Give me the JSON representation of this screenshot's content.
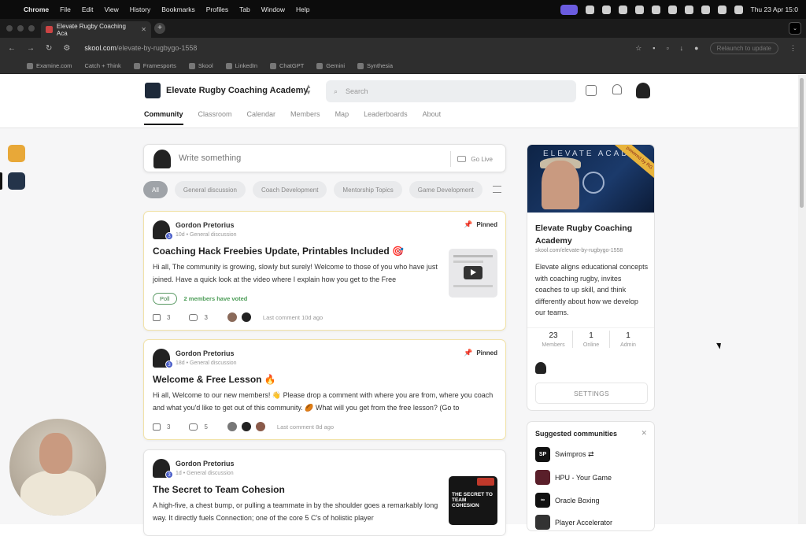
{
  "mac": {
    "app": "Chrome",
    "menus": [
      "File",
      "Edit",
      "View",
      "History",
      "Bookmarks",
      "Profiles",
      "Tab",
      "Window",
      "Help"
    ],
    "clock": "Thu 23 Apr  15:0"
  },
  "browser": {
    "tab_title": "Elevate Rugby Coaching Aca",
    "url_host": "skool.com",
    "url_path": "/elevate-by-rugbygo-1558",
    "relaunch": "Relaunch to update",
    "bookmarks": [
      "Examine.com",
      "Catch + Think",
      "Framesports",
      "Skool",
      "LinkedIn",
      "ChatGPT",
      "Gemini",
      "Synthesia"
    ]
  },
  "header": {
    "community_name": "Elevate Rugby Coaching Academy",
    "search_placeholder": "Search",
    "tabs": [
      "Community",
      "Classroom",
      "Calendar",
      "Members",
      "Map",
      "Leaderboards",
      "About"
    ]
  },
  "composer": {
    "placeholder": "Write something",
    "go_live": "Go Live"
  },
  "filters": [
    "All",
    "General discussion",
    "Coach Development",
    "Mentorship Topics",
    "Game Development"
  ],
  "posts": [
    {
      "author": "Gordon Pretorius",
      "level": "3",
      "meta": "10d • General discussion",
      "pinned": "Pinned",
      "title": "Coaching Hack Freebies Update, Printables Included 🎯",
      "body": "Hi all, The community is growing, slowly but surely! Welcome to those of you who have just joined. Have a quick look at the video where I explain how you get to the Free",
      "poll_tag": "Poll",
      "poll_votes": "2 members have voted",
      "likes": "3",
      "comments": "3",
      "last_comment": "Last comment 10d ago"
    },
    {
      "author": "Gordon Pretorius",
      "level": "3",
      "meta": "18d • General discussion",
      "pinned": "Pinned",
      "title": "Welcome & Free Lesson 🔥",
      "body": "Hi all, Welcome to our new members! 👋 Please drop a comment with where you are from, where you coach and what you'd like to get out of this community. 🏉 What will you get from the free lesson? (Go to",
      "likes": "3",
      "comments": "5",
      "last_comment": "Last comment 8d ago"
    },
    {
      "author": "Gordon Pretorius",
      "level": "3",
      "meta": "1d • General discussion",
      "title": "The Secret to Team Cohesion",
      "body": "A high-five, a chest bump, or pulling a teammate in by the shoulder goes a remarkably long way. It directly fuels Connection; one of the core 5 C's of holistic player",
      "thumb_text": "THE SECRET TO TEAM COHESION"
    }
  ],
  "about_card": {
    "banner_text": "ELEVATE ACADE",
    "banner_ribbon": "powered by RG",
    "title": "Elevate Rugby Coaching Academy",
    "url": "skool.com/elevate-by-rugbygo-1558",
    "description": "Elevate aligns educational concepts with coaching rugby, invites coaches to up skill, and think differently about how we develop our teams.",
    "stats": [
      {
        "value": "23",
        "label": "Members"
      },
      {
        "value": "1",
        "label": "Online"
      },
      {
        "value": "1",
        "label": "Admin"
      }
    ],
    "settings": "SETTINGS"
  },
  "suggested": {
    "title": "Suggested communities",
    "items": [
      {
        "abbr": "SP",
        "name": "Swimpros ⇄"
      },
      {
        "abbr": "",
        "name": "HPU - Your Game"
      },
      {
        "abbr": "∞",
        "name": "Oracle Boxing"
      },
      {
        "abbr": "",
        "name": "Player Accelerator"
      }
    ]
  },
  "colors": {
    "pinned_border": "#f1e2a8",
    "poll_green": "#4b9c56",
    "level_blue": "#4a5ec9"
  }
}
